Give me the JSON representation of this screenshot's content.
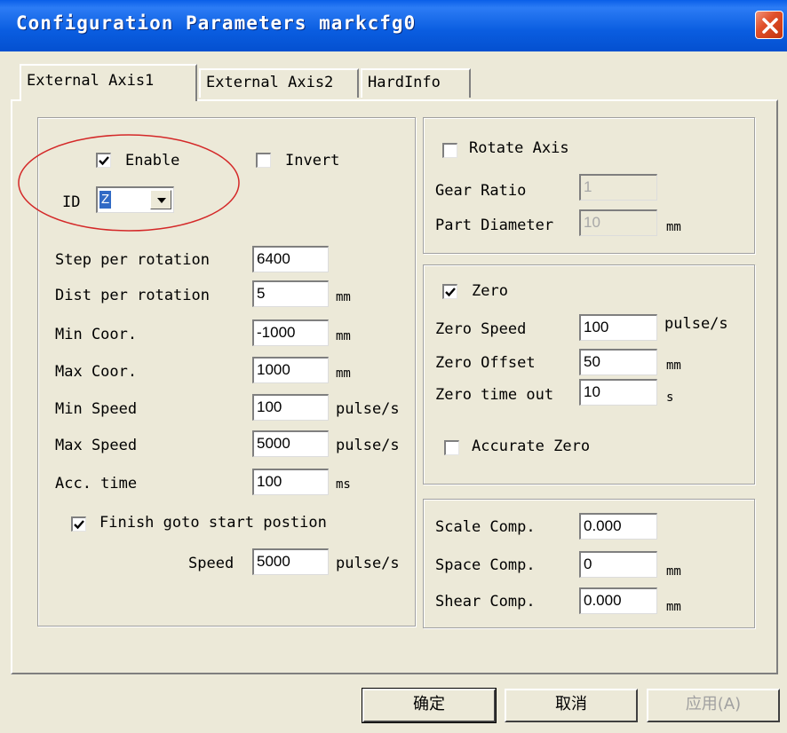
{
  "window": {
    "title": "Configuration Parameters markcfg0"
  },
  "tabs": [
    {
      "label": "External Axis1",
      "active": true
    },
    {
      "label": "External Axis2",
      "active": false
    },
    {
      "label": "HardInfo",
      "active": false
    }
  ],
  "axis": {
    "enable_label": "Enable",
    "enable_checked": true,
    "invert_label": "Invert",
    "invert_checked": false,
    "id_label": "ID",
    "id_value": "Z",
    "rows": [
      {
        "label": "Step per rotation",
        "value": "6400",
        "unit": ""
      },
      {
        "label": "Dist per rotation",
        "value": "5",
        "unit": "mm"
      },
      {
        "label": "Min Coor.",
        "value": "-1000",
        "unit": "mm"
      },
      {
        "label": "Max Coor.",
        "value": "1000",
        "unit": "mm"
      },
      {
        "label": "Min Speed",
        "value": "100",
        "unit": "pulse/s"
      },
      {
        "label": "Max Speed",
        "value": "5000",
        "unit": "pulse/s"
      },
      {
        "label": "Acc. time",
        "value": "100",
        "unit": "ms"
      }
    ],
    "finish_goto_label": "Finish goto start postion",
    "finish_goto_checked": true,
    "speed_label": "Speed",
    "speed_value": "5000",
    "speed_unit": "pulse/s"
  },
  "rotate": {
    "label": "Rotate Axis",
    "checked": false,
    "gear_ratio_label": "Gear Ratio",
    "gear_ratio_value": "1",
    "part_diameter_label": "Part Diameter",
    "part_diameter_value": "10",
    "part_diameter_unit": "mm"
  },
  "zero": {
    "label": "Zero",
    "checked": true,
    "speed_label": "Zero Speed",
    "speed_value": "100",
    "speed_unit": "pulse/s",
    "offset_label": "Zero Offset",
    "offset_value": "50",
    "offset_unit": "mm",
    "timeout_label": "Zero time out",
    "timeout_value": "10",
    "timeout_unit": "s",
    "accurate_label": "Accurate Zero",
    "accurate_checked": false
  },
  "comp": {
    "scale_label": "Scale Comp.",
    "scale_value": "0.000",
    "space_label": "Space Comp.",
    "space_value": "0",
    "space_unit": "mm",
    "shear_label": "Shear Comp.",
    "shear_value": "0.000",
    "shear_unit": "mm"
  },
  "buttons": {
    "ok": "确定",
    "cancel": "取消",
    "apply": "应用(A)"
  },
  "colors": {
    "titlebar": "#0a5de0",
    "close": "#e0502a",
    "highlight_ellipse": "#d42828",
    "selection": "#316ac5"
  },
  "icons": {
    "close": "close-icon",
    "check": "checkmark-icon",
    "dropdown": "chevron-down-icon"
  }
}
